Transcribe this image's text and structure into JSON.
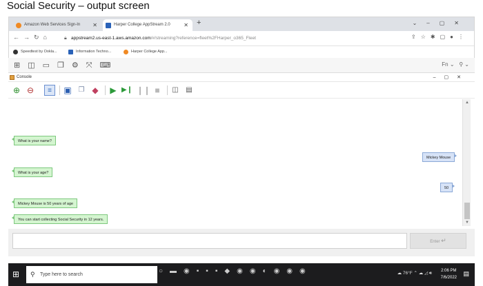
{
  "caption": "Social Security – output screen",
  "browser": {
    "tabs": [
      {
        "label": "Amazon Web Services Sign-In",
        "active": false,
        "favicon_color": "#f08a24"
      },
      {
        "label": "Harper College AppStream 2.0",
        "active": true,
        "favicon_color": "#2a62b8"
      }
    ],
    "new_tab_icon": "plus-icon",
    "address": {
      "host": "appstream2.us-east-1.aws.amazon.com",
      "path": "/#/streaming?reference=fleet%2FHarper_o365_Fleet"
    },
    "bookmarks": [
      {
        "label": "Speedtest by Ookla...",
        "color": "#333333"
      },
      {
        "label": "Information Techno...",
        "color": "#2a62b8"
      },
      {
        "label": "Harper College App...",
        "color": "#f08a24"
      }
    ]
  },
  "appstream": {
    "lang_label": "Fn"
  },
  "console": {
    "title": "Console",
    "messages": [
      {
        "text": "What is your name?",
        "side": "left"
      },
      {
        "text": "Mickey Mouse",
        "side": "right"
      },
      {
        "text": "What is your age?",
        "side": "left"
      },
      {
        "text": "50",
        "side": "right"
      },
      {
        "text": "Mickey Mouse is 50 years of age",
        "side": "left"
      },
      {
        "text": "You can start collecting Social Security in 12 years.",
        "side": "left"
      }
    ],
    "input_value": "",
    "enter_label": "Enter"
  },
  "taskbar": {
    "search_placeholder": "Type here to search",
    "weather": "76°F",
    "time": "2:06 PM",
    "date": "7/6/2022"
  },
  "colors": {
    "user_bubble": "#d4f5d0",
    "reply_bubble": "#d7e3f7",
    "taskbar": "#1c1c1e"
  }
}
